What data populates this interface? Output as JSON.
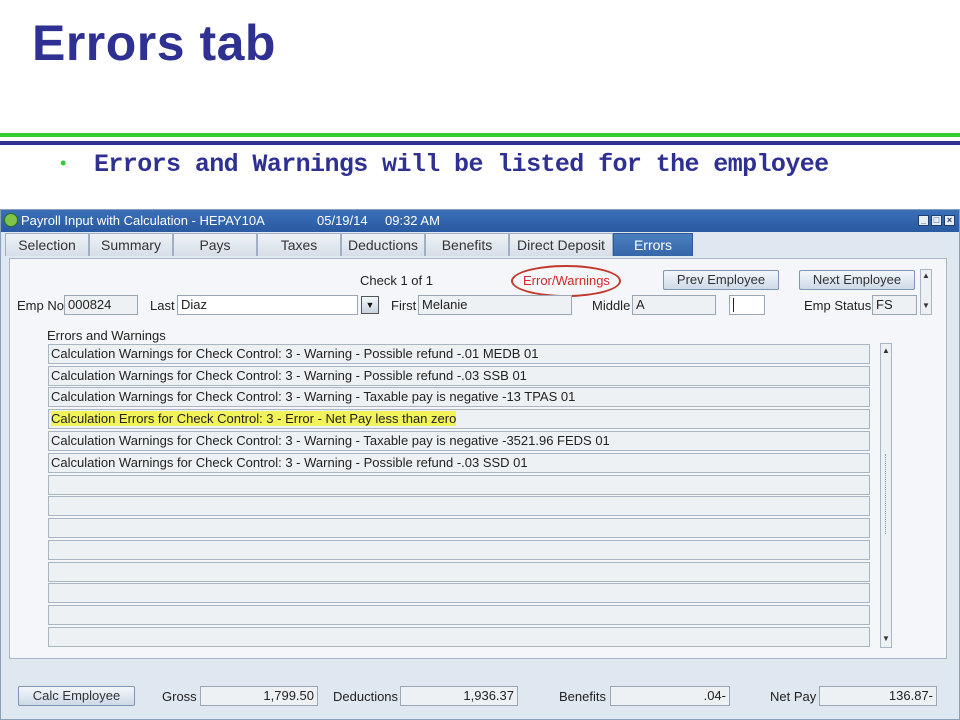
{
  "slide": {
    "title": "Errors tab",
    "bullet": "Errors and Warnings will be listed for the employee"
  },
  "window": {
    "title": "Payroll Input with Calculation - HEPAY10A",
    "date": "05/19/14",
    "time": "09:32 AM"
  },
  "tabs": [
    {
      "label": "Selection"
    },
    {
      "label": "Summary"
    },
    {
      "label": "Pays"
    },
    {
      "label": "Taxes"
    },
    {
      "label": "Deductions"
    },
    {
      "label": "Benefits"
    },
    {
      "label": "Direct Deposit"
    },
    {
      "label": "Errors",
      "active": true
    }
  ],
  "header": {
    "check_label": "Check 1 of 1",
    "error_warnings_link": "Error/Warnings",
    "prev_button": "Prev Employee",
    "next_button": "Next Employee",
    "emp_no_label": "Emp No",
    "emp_no_value": "000824",
    "last_label": "Last",
    "last_value": "Diaz",
    "first_label": "First",
    "first_value": "Melanie",
    "middle_label": "Middle",
    "middle_value": "A",
    "emp_status_label": "Emp Status",
    "emp_status_value": "FS"
  },
  "errors": {
    "section_label": "Errors and Warnings",
    "rows": [
      "Calculation Warnings for Check Control: 3 - Warning - Possible refund -.01 MEDB 01",
      "Calculation Warnings for Check Control: 3 - Warning - Possible refund -.03 SSB 01",
      "Calculation Warnings for Check Control: 3 - Warning - Taxable pay is negative -13 TPAS 01",
      "Calculation Errors for Check Control: 3 - Error - Net Pay less than zero",
      "Calculation Warnings for Check Control: 3 - Warning - Taxable pay is negative -3521.96 FEDS 01",
      "Calculation Warnings for Check Control: 3 - Warning - Possible refund -.03 SSD 01",
      "",
      "",
      "",
      "",
      "",
      "",
      "",
      ""
    ],
    "highlighted_row": 3,
    "highlight_color": "#f2f25a"
  },
  "footer": {
    "calc_button": "Calc Employee",
    "gross_label": "Gross",
    "gross_value": "1,799.50",
    "deductions_label": "Deductions",
    "deductions_value": "1,936.37",
    "benefits_label": "Benefits",
    "benefits_value": ".04-",
    "net_pay_label": "Net Pay",
    "net_pay_value": "136.87-"
  },
  "colors": {
    "title_blue": "#2e3192",
    "rule_green": "#33cc33",
    "active_tab": "#3466a8",
    "link_red": "#d22a2a"
  }
}
